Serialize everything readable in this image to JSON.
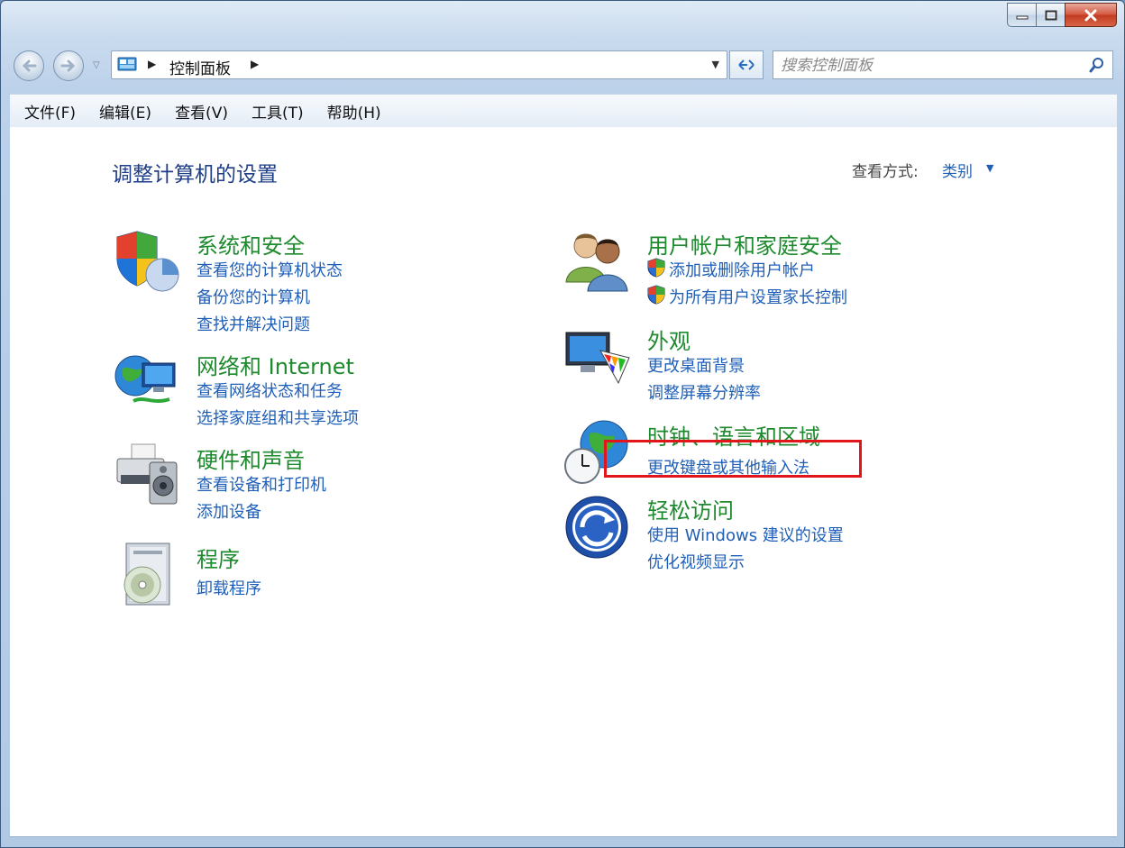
{
  "window": {
    "min_label": "",
    "max_label": "",
    "close_label": ""
  },
  "nav": {
    "address_path": "控制面板",
    "search_placeholder": "搜索控制面板"
  },
  "menu": [
    "文件(F)",
    "编辑(E)",
    "查看(V)",
    "工具(T)",
    "帮助(H)"
  ],
  "page": {
    "title": "调整计算机的设置",
    "view_by_label": "查看方式:",
    "view_by_value": "类别"
  },
  "categories_left": [
    {
      "title": "系统和安全",
      "links": [
        "查看您的计算机状态",
        "备份您的计算机",
        "查找并解决问题"
      ]
    },
    {
      "title": "网络和 Internet",
      "links": [
        "查看网络状态和任务",
        "选择家庭组和共享选项"
      ]
    },
    {
      "title": "硬件和声音",
      "links": [
        "查看设备和打印机",
        "添加设备"
      ]
    },
    {
      "title": "程序",
      "links": [
        "卸载程序"
      ]
    }
  ],
  "categories_right": [
    {
      "title": "用户帐户和家庭安全",
      "links": [
        "添加或删除用户帐户",
        "为所有用户设置家长控制"
      ]
    },
    {
      "title": "外观",
      "links": [
        "更改桌面背景",
        "调整屏幕分辨率"
      ]
    },
    {
      "title": "时钟、语言和区域",
      "links": [
        "更改键盘或其他输入法"
      ]
    },
    {
      "title": "轻松访问",
      "links": [
        "使用 Windows 建议的设置",
        "优化视频显示"
      ]
    }
  ],
  "colors": {
    "category_title": "#1e8a2e",
    "link": "#1f5fb8",
    "highlight_box": "#e0161a"
  }
}
